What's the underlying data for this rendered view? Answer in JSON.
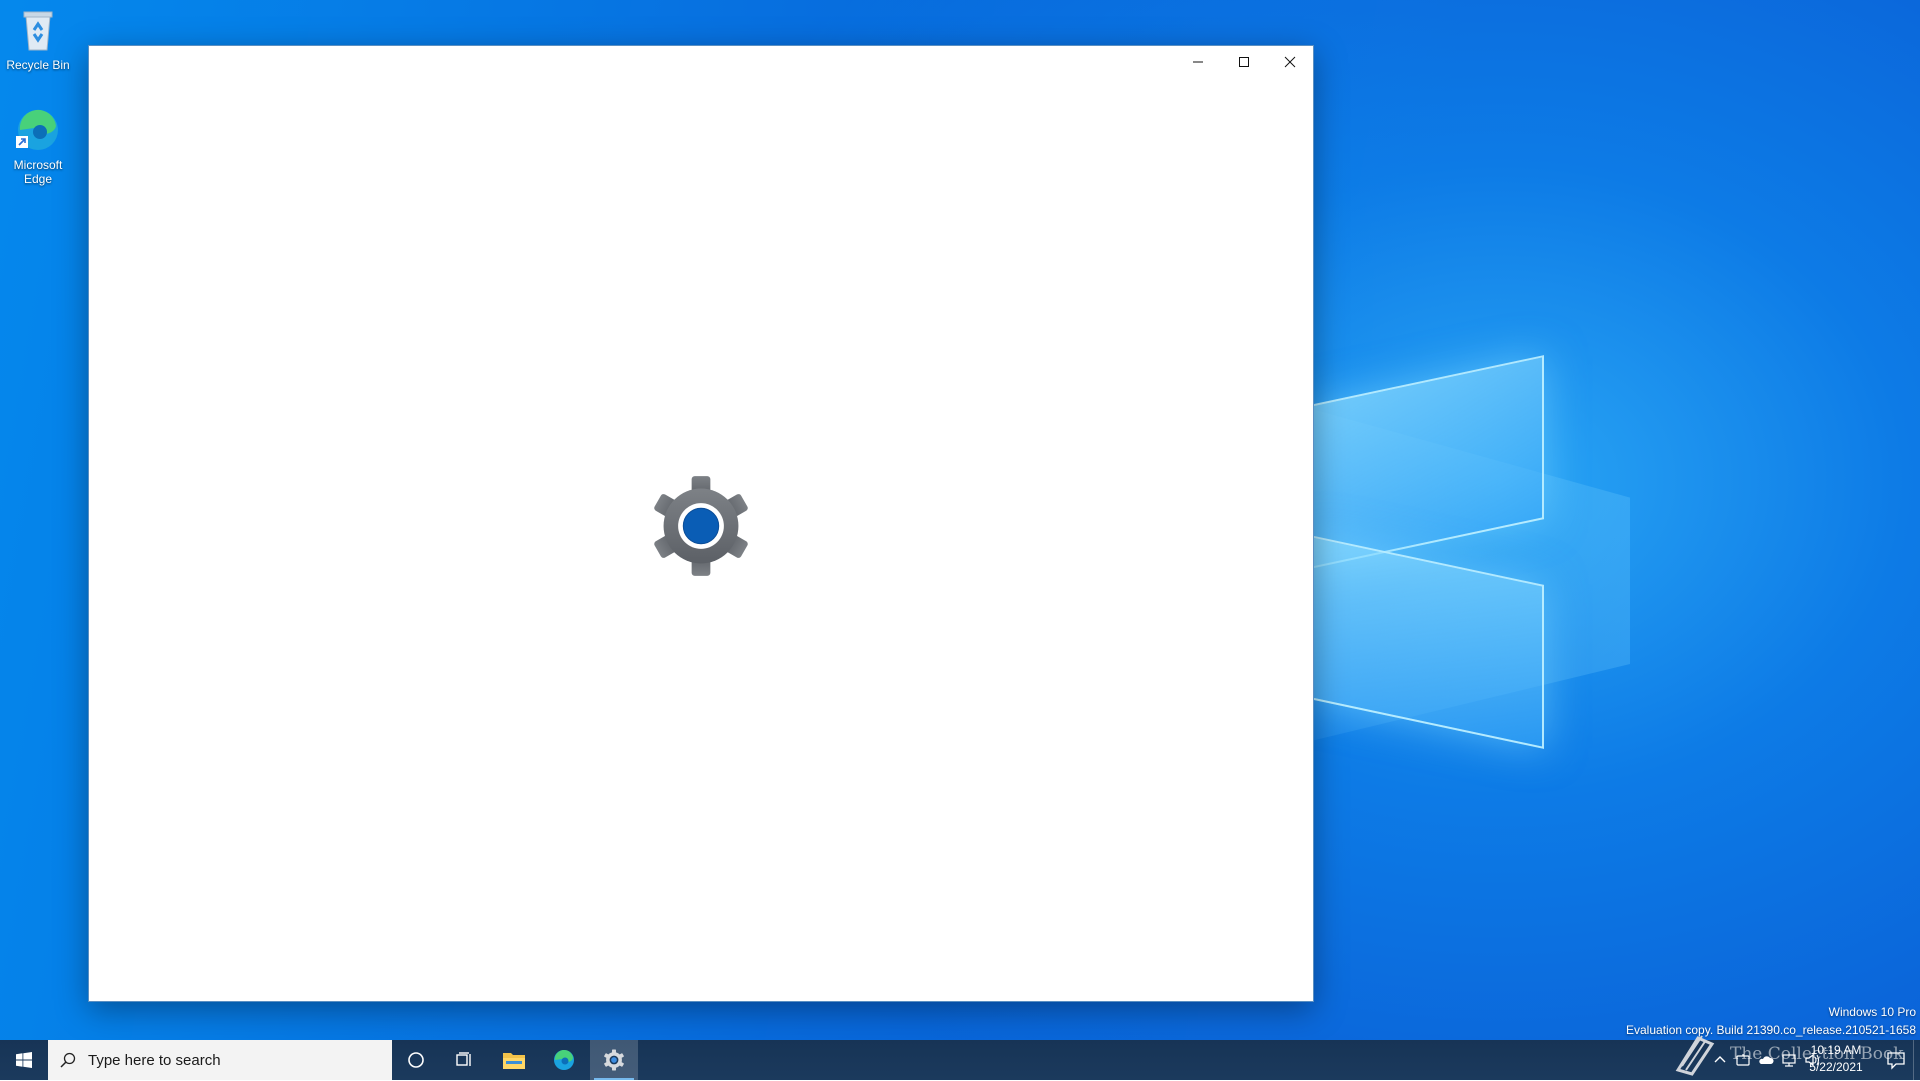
{
  "desktop": {
    "icons": [
      {
        "label": "Recycle Bin"
      },
      {
        "label": "Microsoft Edge"
      }
    ],
    "watermark": {
      "edition": "Windows 10 Pro",
      "build": "Evaluation copy. Build 21390.co_release.210521-1658"
    },
    "overlay_text": "The Collection Book"
  },
  "window": {
    "state": "loading",
    "splash_icon": "settings-gear-icon",
    "caption_buttons": [
      "minimize",
      "maximize",
      "close"
    ]
  },
  "taskbar": {
    "search_placeholder": "Type here to search",
    "pinned": [
      "cortana-icon",
      "task-view-icon",
      "file-explorer-icon",
      "edge-icon",
      "settings-icon"
    ],
    "active_app": "Settings",
    "clock": {
      "time": "10:19 AM",
      "date": "5/22/2021"
    }
  },
  "colors": {
    "accent": "#0063b1",
    "taskbar": "#1b3a5d",
    "gear": "#6f7378"
  }
}
